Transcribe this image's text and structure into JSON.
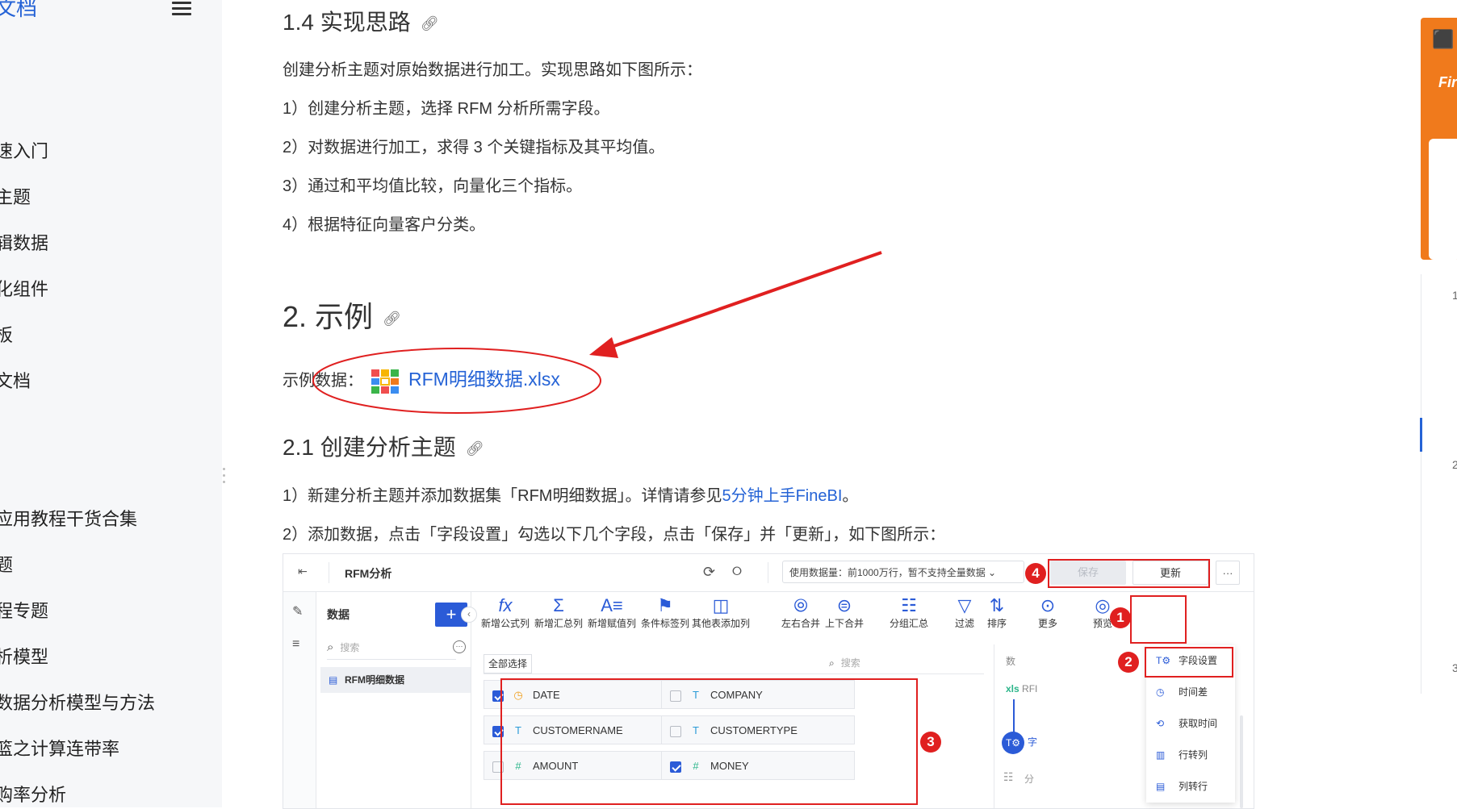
{
  "sidebar": {
    "brand": "文档",
    "items": [
      "",
      "",
      "速入门",
      "主题",
      "辑数据",
      "化组件",
      "板",
      "文档",
      "",
      "",
      "应用教程干货合集",
      "题",
      "程专题",
      "析模型",
      "数据分析模型与方法",
      "篮之计算连带率",
      "购率分析"
    ]
  },
  "main": {
    "h_14": "1.4 实现思路",
    "intro": "创建分析主题对原始数据进行加工。实现思路如下图所示：",
    "steps": [
      "1）创建分析主题，选择 RFM 分析所需字段。",
      "2）对数据进行加工，求得 3 个关键指标及其平均值。",
      "3）通过和平均值比较，向量化三个指标。",
      "4）根据特征向量客户分类。"
    ],
    "h_2": "2. 示例",
    "sample_label": "示例数据：",
    "sample_file": "RFM明细数据.xlsx",
    "h_21": "2.1 创建分析主题",
    "p1_prefix": "1）新建分析主题并添加数据集「RFM明细数据」。详情请参见",
    "p1_link": "5分钟上手FineBI",
    "p1_suffix": "。",
    "p2": "2）添加数据，点击「字段设置」勾选以下几个字段，点击「保存」并「更新」，如下图所示："
  },
  "app": {
    "title": "RFM分析",
    "data_info": "使用数据量：前1000万行，暂不支持全量数据",
    "save": "保存",
    "update": "更新",
    "more_dots": "···",
    "panel_title": "数据",
    "panel_search": "搜索",
    "dataset": "RFM明细数据",
    "tools": [
      "新增公式列",
      "新增汇总列",
      "新增赋值列",
      "条件标签列",
      "其他表添加列",
      "左右合并",
      "上下合并",
      "分组汇总",
      "过滤",
      "排序",
      "更多",
      "预览"
    ],
    "select_all": "全部选择",
    "field_search": "搜索",
    "fields": [
      {
        "name": "DATE",
        "checked": true,
        "type": "date-icon"
      },
      {
        "name": "COMPANY",
        "checked": false,
        "type": "text-icon"
      },
      {
        "name": "CUSTOMERNAME",
        "checked": true,
        "type": "text-icon"
      },
      {
        "name": "CUSTOMERTYPE",
        "checked": false,
        "type": "text-icon"
      },
      {
        "name": "AMOUNT",
        "checked": false,
        "type": "number-icon"
      },
      {
        "name": "MONEY",
        "checked": true,
        "type": "number-icon"
      }
    ],
    "menu": [
      "字段设置",
      "时间差",
      "获取时间",
      "行转列",
      "列转行"
    ],
    "side_label_1": "数",
    "side_label_2": "RFI",
    "side_label_3": "字",
    "side_label_4": "分",
    "badges": [
      "1",
      "2",
      "3",
      "4"
    ]
  },
  "rail": {
    "toc_numbers": [
      "1",
      "2",
      "3"
    ],
    "banner_brand": "Fir"
  },
  "colors": {
    "accent": "#2563d6",
    "annotation": "#e02020",
    "banner": "#f07a1c"
  }
}
